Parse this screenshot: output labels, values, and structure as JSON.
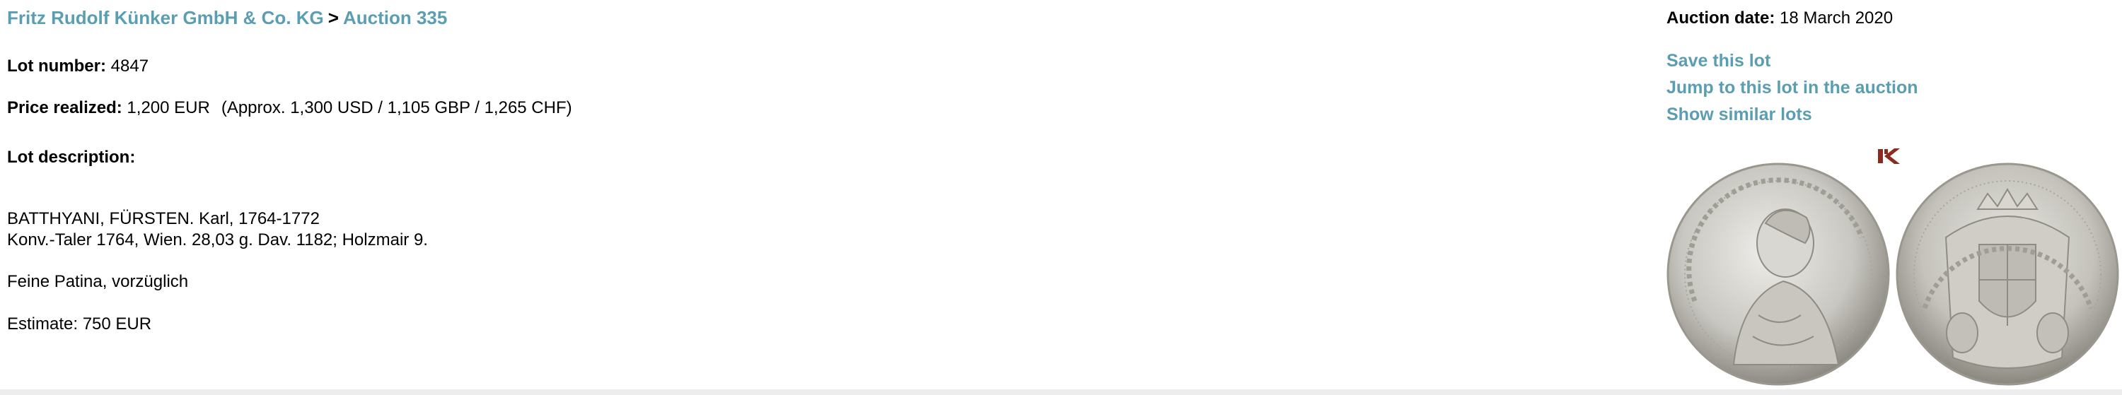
{
  "breadcrumb": {
    "house": "Fritz Rudolf Künker GmbH & Co. KG",
    "separator": ">",
    "auction": "Auction 335"
  },
  "lot": {
    "number_label": "Lot number:",
    "number": "4847",
    "price_label": "Price realized:",
    "price": "1,200 EUR",
    "price_approx": "(Approx. 1,300 USD / 1,105 GBP / 1,265 CHF)",
    "description_label": "Lot description:",
    "description_title": "BATTHYANI, FÜRSTEN. Karl, 1764-1772",
    "description_detail": "Konv.-Taler 1764, Wien. 28,03 g. Dav. 1182; Holzmair 9.",
    "grade": "Feine Patina, vorzüglich",
    "estimate": "Estimate: 750 EUR"
  },
  "sidebar": {
    "auction_date_label": "Auction date:",
    "auction_date": "18 March 2020",
    "links": {
      "save": "Save this lot",
      "jump": "Jump to this lot in the auction",
      "similar": "Show similar lots"
    }
  },
  "colors": {
    "link": "#5b9eb1",
    "logo": "#8b2a1e",
    "silver": "#c8c6c0"
  },
  "icons": {
    "logo": "kuenker-logo-icon",
    "coin_image": "coin-obverse-reverse-image"
  }
}
